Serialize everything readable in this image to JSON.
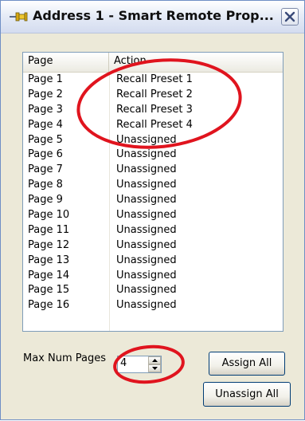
{
  "window": {
    "title": "Address 1 - Smart Remote Prop...",
    "title_icon": "pushpin-icon",
    "close_icon": "close-icon"
  },
  "list": {
    "columns": [
      "Page",
      "Action"
    ],
    "rows": [
      {
        "page": "Page 1",
        "action": "Recall Preset 1"
      },
      {
        "page": "Page 2",
        "action": "Recall Preset 2"
      },
      {
        "page": "Page 3",
        "action": "Recall Preset 3"
      },
      {
        "page": "Page 4",
        "action": "Recall Preset 4"
      },
      {
        "page": "Page 5",
        "action": "Unassigned"
      },
      {
        "page": "Page 6",
        "action": "Unassigned"
      },
      {
        "page": "Page 7",
        "action": "Unassigned"
      },
      {
        "page": "Page 8",
        "action": "Unassigned"
      },
      {
        "page": "Page 9",
        "action": "Unassigned"
      },
      {
        "page": "Page 10",
        "action": "Unassigned"
      },
      {
        "page": "Page 11",
        "action": "Unassigned"
      },
      {
        "page": "Page 12",
        "action": "Unassigned"
      },
      {
        "page": "Page 13",
        "action": "Unassigned"
      },
      {
        "page": "Page 14",
        "action": "Unassigned"
      },
      {
        "page": "Page 15",
        "action": "Unassigned"
      },
      {
        "page": "Page 16",
        "action": "Unassigned"
      }
    ]
  },
  "controls": {
    "max_num_pages_label": "Max Num Pages",
    "max_num_pages_value": "4",
    "assign_all_label": "Assign All",
    "unassign_all_label": "Unassign All"
  },
  "colors": {
    "annotation_red": "#e0141e",
    "window_bg": "#ece9d8"
  }
}
